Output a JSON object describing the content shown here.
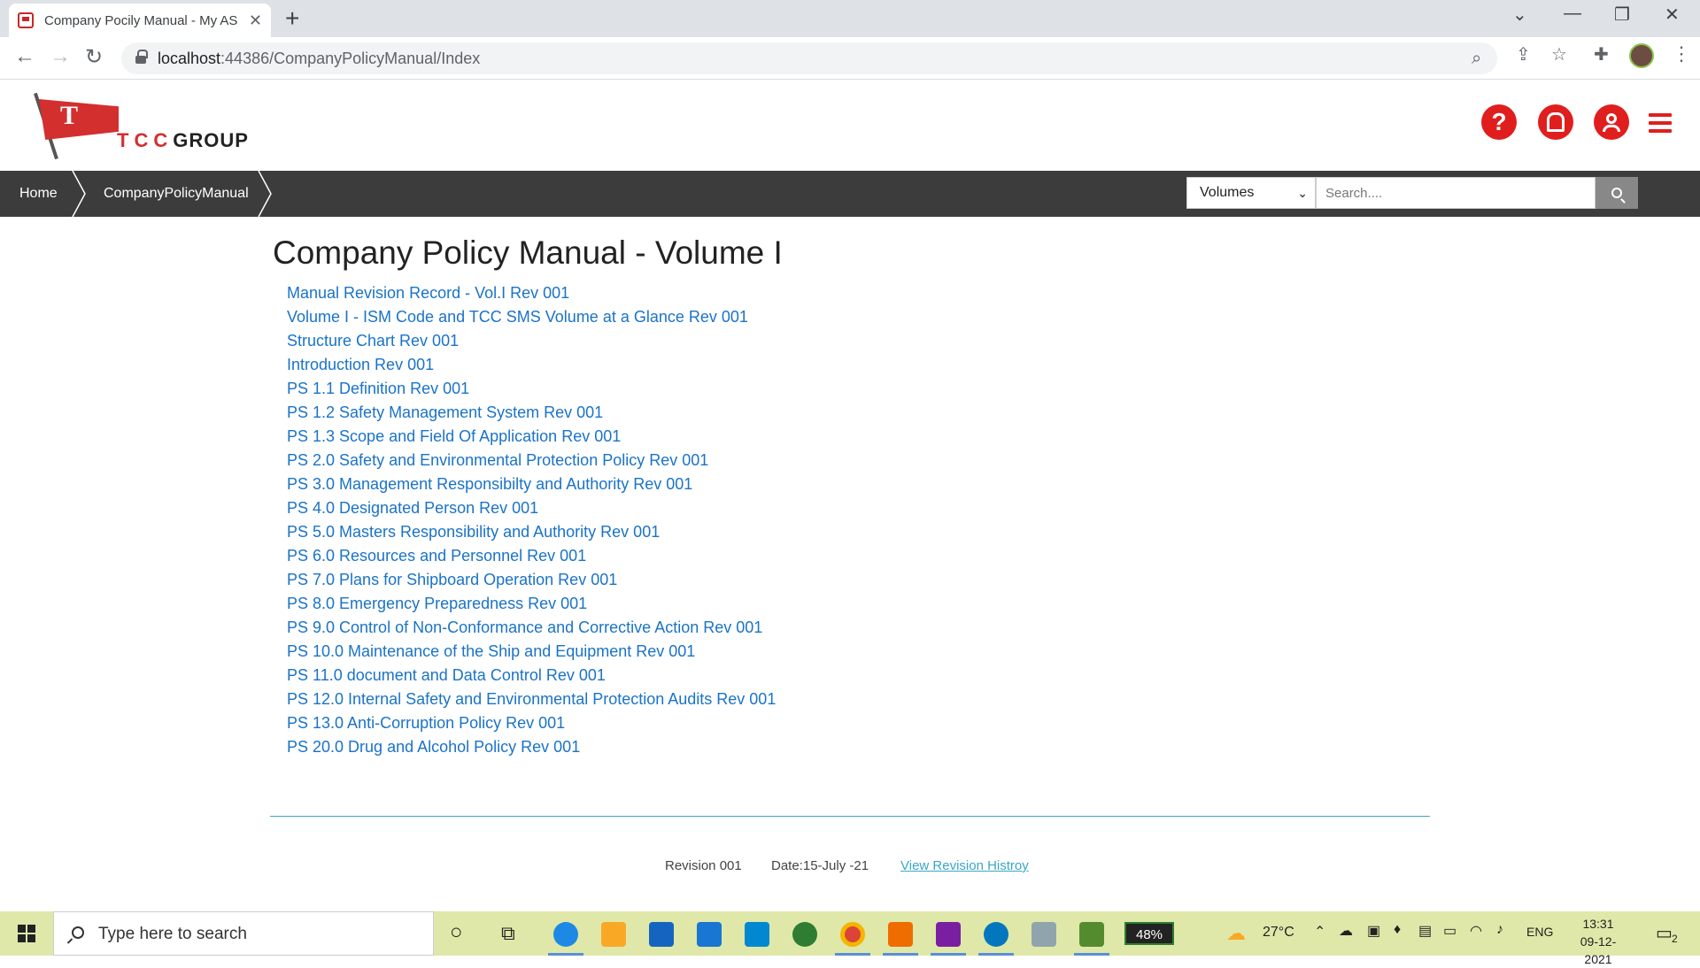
{
  "browser": {
    "tab_title": "Company Pocily Manual - My AS",
    "url_host": "localhost",
    "url_path": ":44386/CompanyPolicyManual/Index"
  },
  "header": {
    "logo_flag_letter": "T",
    "brand_tcc": "TCC",
    "brand_group": "GROUP",
    "help_label": "?"
  },
  "breadcrumb": {
    "home": "Home",
    "current": "CompanyPolicyManual"
  },
  "search": {
    "volume_selected": "Volumes",
    "placeholder": "Search...."
  },
  "main": {
    "title": "Company Policy Manual - Volume I",
    "documents": [
      "Manual Revision Record - Vol.I Rev 001",
      "Volume I - ISM Code and TCC SMS Volume at a Glance Rev 001",
      "Structure Chart Rev 001",
      "Introduction Rev 001",
      "PS 1.1 Definition Rev 001",
      "PS 1.2 Safety Management System Rev 001",
      "PS 1.3 Scope and Field Of Application Rev 001",
      "PS 2.0 Safety and Environmental Protection Policy Rev 001",
      "PS 3.0 Management Responsibilty and Authority Rev 001",
      "PS 4.0 Designated Person Rev 001",
      "PS 5.0 Masters Responsibility and Authority Rev 001",
      "PS 6.0 Resources and Personnel Rev 001",
      "PS 7.0 Plans for Shipboard Operation Rev 001",
      "PS 8.0 Emergency Preparedness Rev 001",
      "PS 9.0 Control of Non-Conformance and Corrective Action Rev 001",
      "PS 10.0 Maintenance of the Ship and Equipment Rev 001",
      "PS 11.0 document and Data Control Rev 001",
      "PS 12.0 Internal Safety and Environmental Protection Audits Rev 001",
      "PS 13.0 Anti-Corruption Policy Rev 001",
      "PS 20.0 Drug and Alcohol Policy Rev 001"
    ]
  },
  "footer": {
    "revision": "Revision 001",
    "date": "Date:15-July -21",
    "history_link": "View Revision Histroy"
  },
  "taskbar": {
    "search_placeholder": "Type here to search",
    "battery": "48%",
    "temperature": "27°C",
    "language": "ENG",
    "time": "13:31",
    "date": "09-12-2021",
    "notifications": "2"
  },
  "colors": {
    "brand_red": "#e01e1e",
    "link_blue": "#1a73c8",
    "crumb_bar": "#3c3c3c",
    "accent_teal": "#3aa6c9"
  }
}
